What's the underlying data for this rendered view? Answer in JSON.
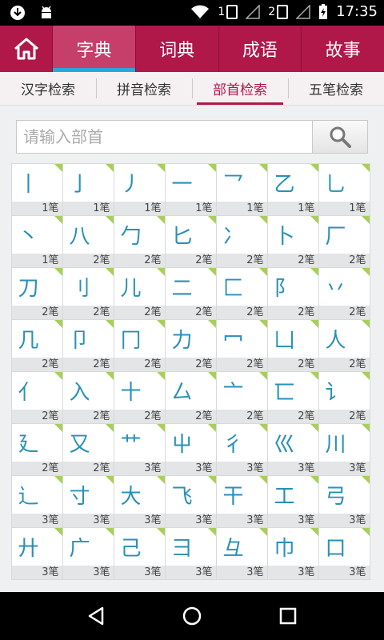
{
  "status": {
    "time": "17:35",
    "sim1": "1",
    "sim2": "2"
  },
  "top_tabs": [
    "字典",
    "词典",
    "成语",
    "故事"
  ],
  "sub_tabs": [
    "汉字检索",
    "拼音检索",
    "部首检索",
    "五笔检索"
  ],
  "search": {
    "placeholder": "请输入部首"
  },
  "radicals": [
    {
      "char": "丨",
      "strokes": "1笔"
    },
    {
      "char": "亅",
      "strokes": "1笔"
    },
    {
      "char": "丿",
      "strokes": "1笔"
    },
    {
      "char": "一",
      "strokes": "1笔"
    },
    {
      "char": "乛",
      "strokes": "1笔"
    },
    {
      "char": "乙",
      "strokes": "1笔"
    },
    {
      "char": "乚",
      "strokes": "1笔"
    },
    {
      "char": "丶",
      "strokes": "1笔"
    },
    {
      "char": "八",
      "strokes": "2笔"
    },
    {
      "char": "勹",
      "strokes": "2笔"
    },
    {
      "char": "匕",
      "strokes": "2笔"
    },
    {
      "char": "冫",
      "strokes": "2笔"
    },
    {
      "char": "卜",
      "strokes": "2笔"
    },
    {
      "char": "厂",
      "strokes": "2笔"
    },
    {
      "char": "刀",
      "strokes": "2笔"
    },
    {
      "char": "刂",
      "strokes": "2笔"
    },
    {
      "char": "儿",
      "strokes": "2笔"
    },
    {
      "char": "二",
      "strokes": "2笔"
    },
    {
      "char": "匚",
      "strokes": "2笔"
    },
    {
      "char": "阝",
      "strokes": "2笔"
    },
    {
      "char": "丷",
      "strokes": "2笔"
    },
    {
      "char": "几",
      "strokes": "2笔"
    },
    {
      "char": "卩",
      "strokes": "2笔"
    },
    {
      "char": "冂",
      "strokes": "2笔"
    },
    {
      "char": "力",
      "strokes": "2笔"
    },
    {
      "char": "冖",
      "strokes": "2笔"
    },
    {
      "char": "凵",
      "strokes": "2笔"
    },
    {
      "char": "人",
      "strokes": "2笔"
    },
    {
      "char": "亻",
      "strokes": "2笔"
    },
    {
      "char": "入",
      "strokes": "2笔"
    },
    {
      "char": "十",
      "strokes": "2笔"
    },
    {
      "char": "厶",
      "strokes": "2笔"
    },
    {
      "char": "亠",
      "strokes": "2笔"
    },
    {
      "char": "匸",
      "strokes": "2笔"
    },
    {
      "char": "讠",
      "strokes": "2笔"
    },
    {
      "char": "廴",
      "strokes": "2笔"
    },
    {
      "char": "又",
      "strokes": "2笔"
    },
    {
      "char": "艹",
      "strokes": "3笔"
    },
    {
      "char": "屮",
      "strokes": "3笔"
    },
    {
      "char": "彳",
      "strokes": "3笔"
    },
    {
      "char": "巛",
      "strokes": "3笔"
    },
    {
      "char": "川",
      "strokes": "3笔"
    },
    {
      "char": "辶",
      "strokes": "3笔"
    },
    {
      "char": "寸",
      "strokes": "3笔"
    },
    {
      "char": "大",
      "strokes": "3笔"
    },
    {
      "char": "飞",
      "strokes": "3笔"
    },
    {
      "char": "干",
      "strokes": "3笔"
    },
    {
      "char": "工",
      "strokes": "3笔"
    },
    {
      "char": "弓",
      "strokes": "3笔"
    },
    {
      "char": "廾",
      "strokes": "3笔"
    },
    {
      "char": "广",
      "strokes": "3笔"
    },
    {
      "char": "己",
      "strokes": "3笔"
    },
    {
      "char": "彐",
      "strokes": "3笔"
    },
    {
      "char": "彑",
      "strokes": "3笔"
    },
    {
      "char": "巾",
      "strokes": "3笔"
    },
    {
      "char": "口",
      "strokes": "3笔"
    }
  ]
}
